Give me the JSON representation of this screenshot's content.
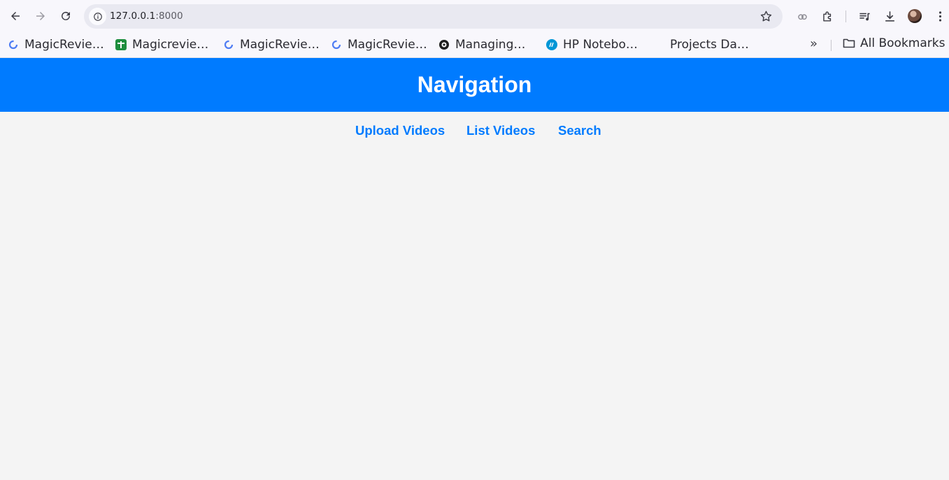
{
  "browser": {
    "url_host": "127.0.0.1",
    "url_port": ":8000",
    "bookmarks": [
      {
        "label": "MagicRevie…",
        "icon": "magicreview-icon",
        "color": "#4f7df3"
      },
      {
        "label": "Magicrevie…",
        "icon": "sheets-icon",
        "color": "#1e8e3e"
      },
      {
        "label": "MagicRevie…",
        "icon": "magicreview-icon",
        "color": "#4f7df3"
      },
      {
        "label": "MagicRevie…",
        "icon": "magicreview-icon",
        "color": "#4f7df3"
      },
      {
        "label": "Managing…",
        "icon": "github-icon",
        "color": "#1f1f1f"
      },
      {
        "label": "HP Notebo…",
        "icon": "hp-icon",
        "color": "#0096d6"
      },
      {
        "label": "Projects Da…",
        "icon": "",
        "color": ""
      }
    ],
    "more_label": "»",
    "all_bookmarks_label": "All Bookmarks"
  },
  "page": {
    "header_title": "Navigation",
    "nav_links": [
      "Upload Videos",
      "List Videos",
      "Search"
    ],
    "accent_color": "#007bff",
    "background_color": "#f4f4f4"
  }
}
